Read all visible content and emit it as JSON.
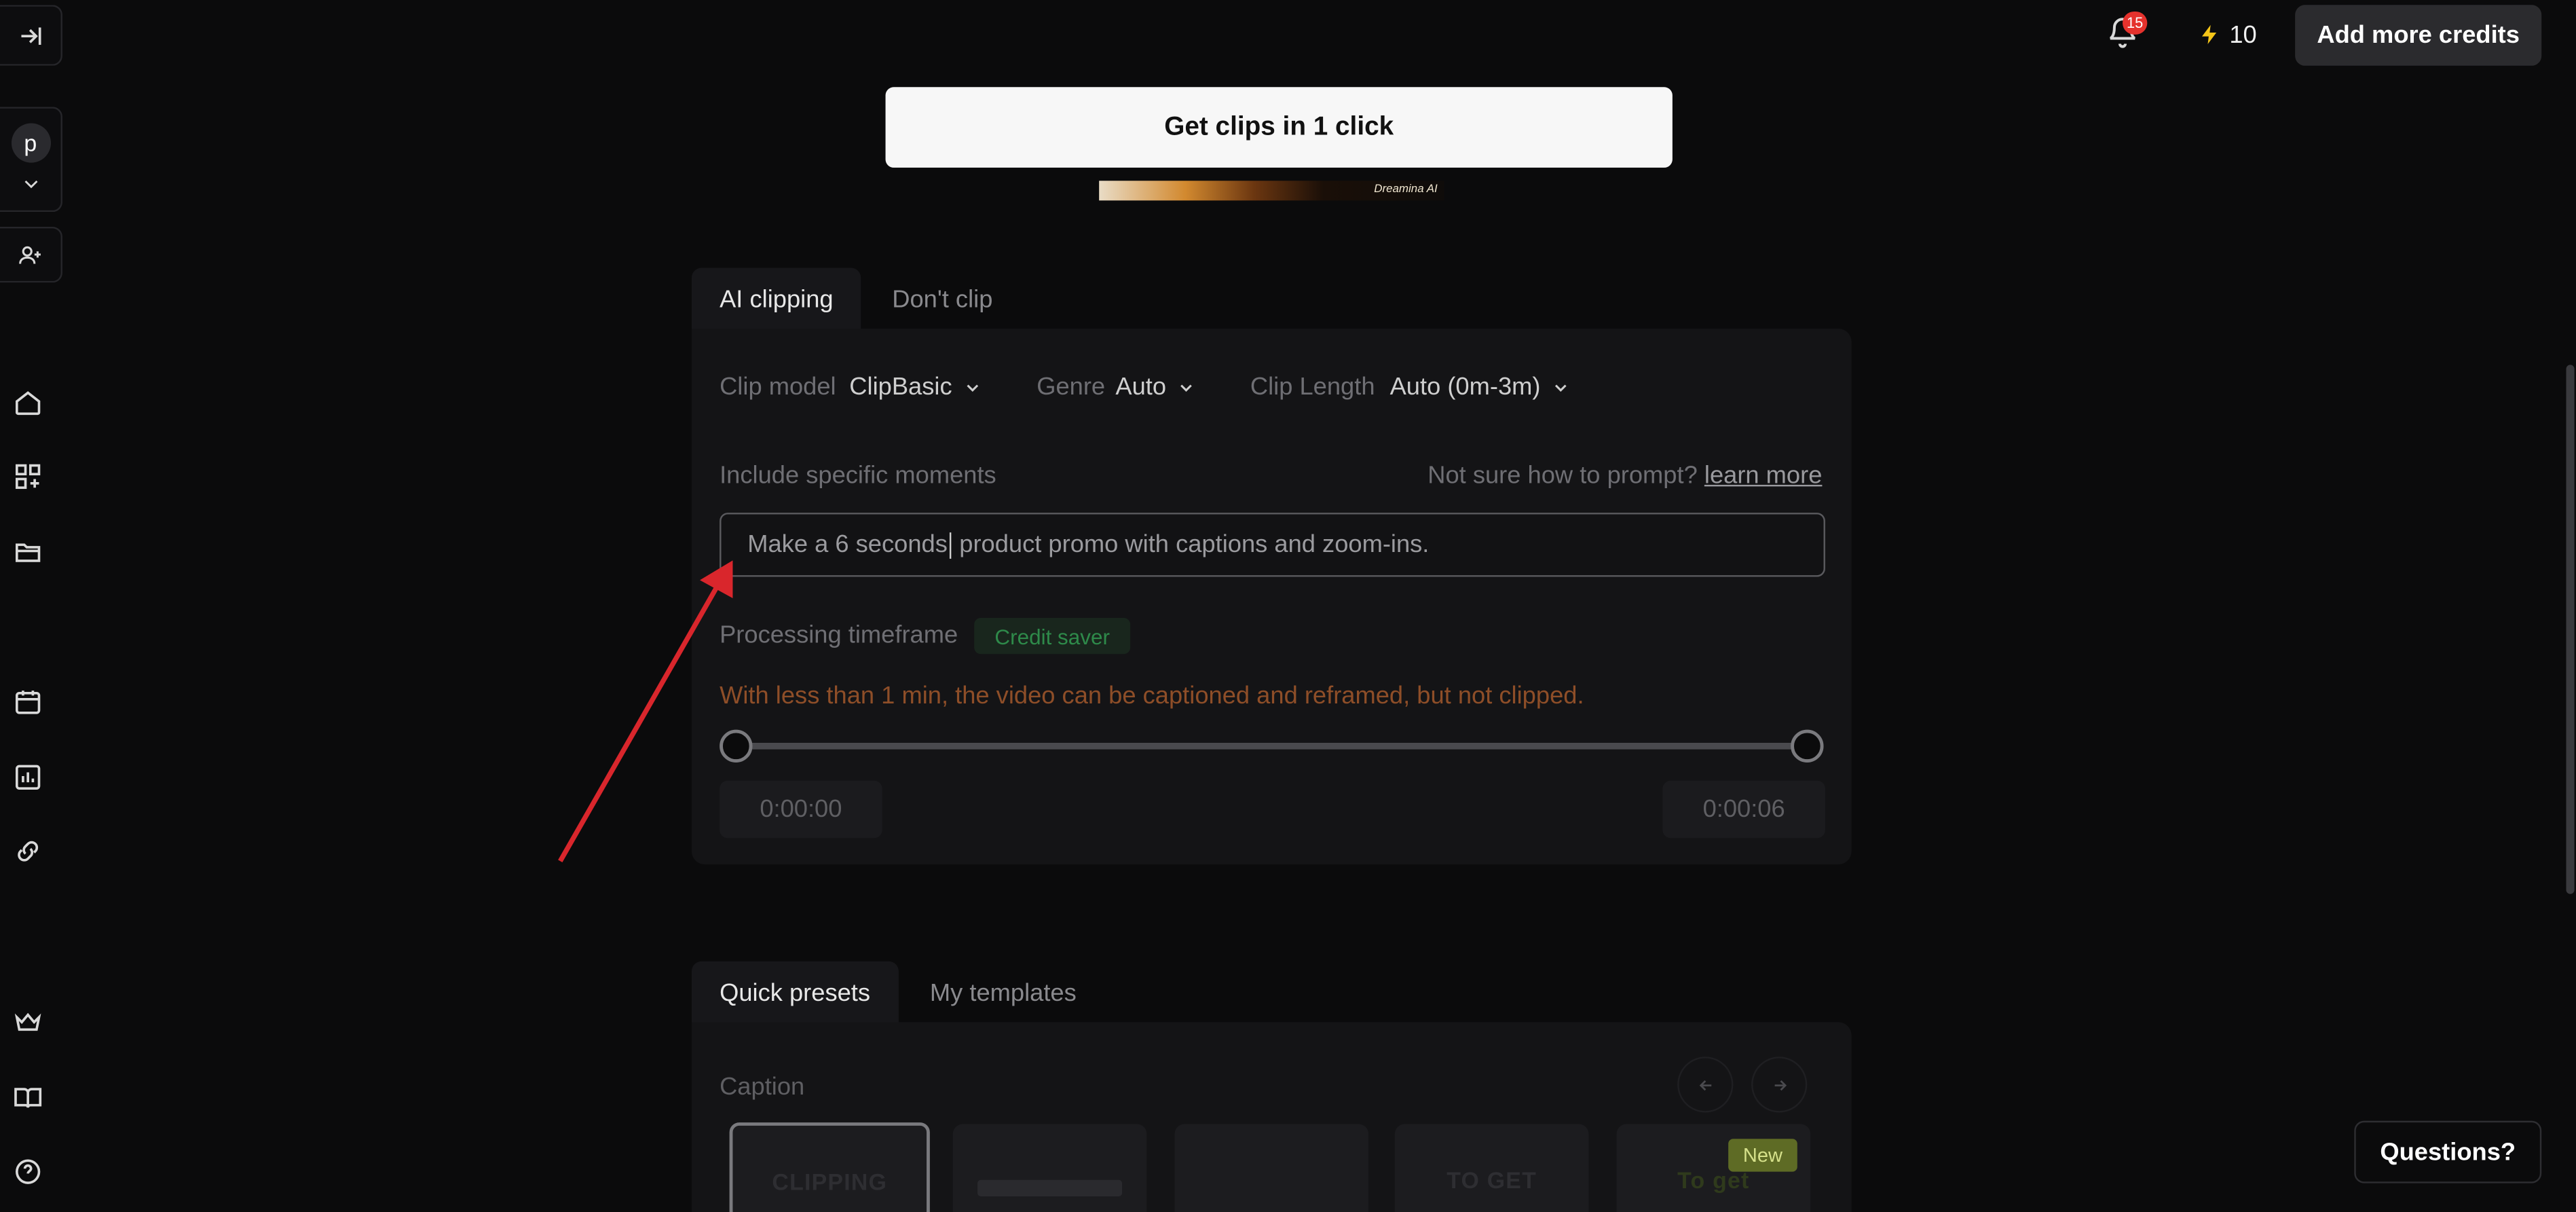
{
  "header": {
    "notification_count": "15",
    "credits": "10",
    "add_credits_label": "Add more credits"
  },
  "sidebar": {
    "avatar_letter": "p",
    "icons": [
      "collapse-sidebar-icon",
      "chevron-down-icon",
      "add-user-icon",
      "home-icon",
      "apps-icon",
      "folder-icon",
      "calendar-icon",
      "analytics-icon",
      "link-icon",
      "crown-icon",
      "book-icon",
      "help-icon"
    ]
  },
  "cta": {
    "get_clips_label": "Get clips in 1 click",
    "thumbnail_text": "Dreamina AI"
  },
  "clip_tabs": {
    "ai_clipping": "AI clipping",
    "dont_clip": "Don't clip"
  },
  "clip_settings": {
    "clip_model_label": "Clip model",
    "clip_model_value": "ClipBasic",
    "genre_label": "Genre",
    "genre_value": "Auto",
    "clip_length_label": "Clip Length",
    "clip_length_value": "Auto (0m-3m)"
  },
  "moments": {
    "label": "Include specific moments",
    "hint": "Not sure how to prompt?",
    "learn_more": "learn more",
    "prompt_before_caret": "Make a 6 seconds",
    "prompt_after_caret": " product promo with captions and zoom-ins."
  },
  "timeframe": {
    "label": "Processing timeframe",
    "badge": "Credit saver",
    "warning": "With less than 1 min, the video can be captioned and reframed, but not clipped.",
    "start": "0:00:00",
    "end": "0:00:06",
    "range_fraction": [
      0,
      1
    ]
  },
  "preset_tabs": {
    "quick_presets": "Quick presets",
    "my_templates": "My templates"
  },
  "caption": {
    "label": "Caption",
    "cards": [
      "CLIPPING",
      "",
      "",
      "TO GET",
      "To get"
    ],
    "new_badge": "New"
  },
  "questions_label": "Questions?",
  "colors": {
    "background": "#0b0b0c",
    "badge_red": "#e5322d",
    "credit_bolt": "#f5c518",
    "credit_saver": "#2e8a4a",
    "warning": "#8e4e28",
    "annotation_arrow": "#d9262c"
  }
}
